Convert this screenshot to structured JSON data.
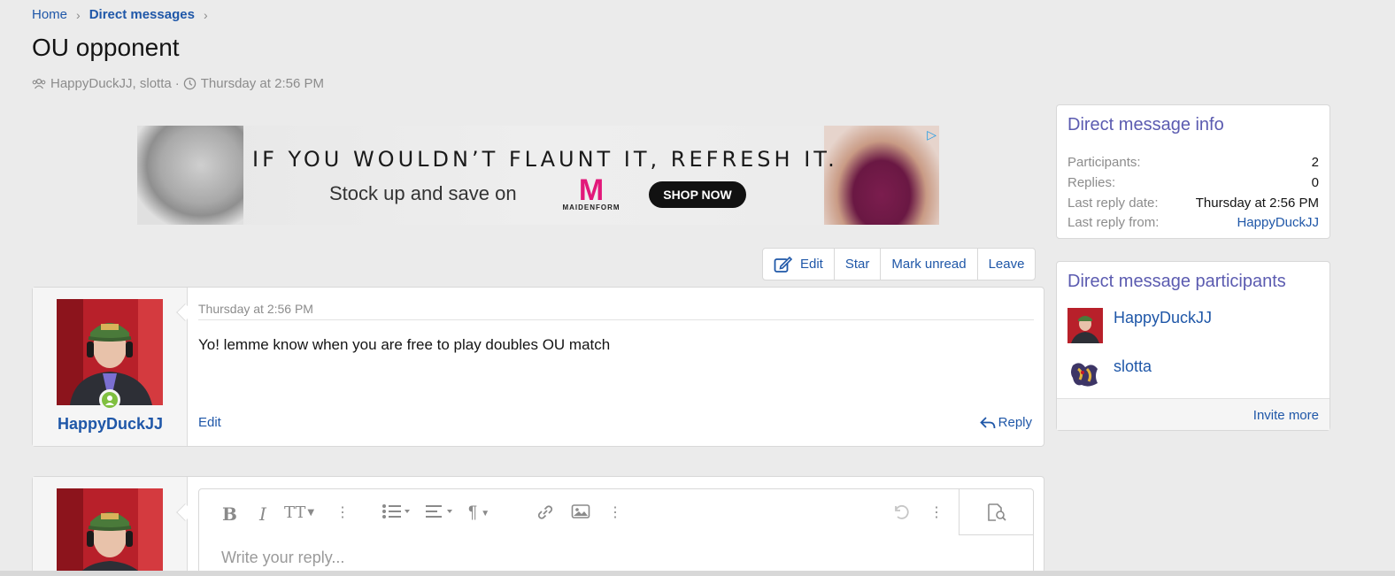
{
  "breadcrumb": {
    "home": "Home",
    "section": "Direct messages",
    "separator": "›"
  },
  "thread": {
    "title": "OU opponent",
    "participants_text": "HappyDuckJJ, slotta",
    "dot": "·",
    "date": "Thursday at 2:56 PM"
  },
  "ad": {
    "headline": "IF YOU WOULDN’T FLAUNT IT, REFRESH IT.",
    "subline": "Stock up and save on",
    "brand_mark": "M",
    "brand_name": "MAIDENFORM",
    "cta": "SHOP NOW",
    "badge": "▷"
  },
  "actions": {
    "edit": "Edit",
    "star": "Star",
    "mark_unread": "Mark unread",
    "leave": "Leave"
  },
  "message": {
    "author": "HappyDuckJJ",
    "date": "Thursday at 2:56 PM",
    "body": "Yo! lemme know when you are free to play doubles OU match",
    "edit_label": "Edit",
    "reply_label": "Reply"
  },
  "reply_editor": {
    "placeholder": "Write your reply...",
    "icons": [
      "bold-icon",
      "italic-icon",
      "text-size-icon",
      "more-vertical-icon",
      "list-icon",
      "align-icon",
      "paragraph-icon",
      "link-icon",
      "image-icon",
      "undo-icon",
      "preview-icon"
    ]
  },
  "info_block": {
    "title": "Direct message info",
    "rows": [
      {
        "label": "Participants:",
        "value": "2"
      },
      {
        "label": "Replies:",
        "value": "0"
      },
      {
        "label": "Last reply date:",
        "value": "Thursday at 2:56 PM"
      },
      {
        "label": "Last reply from:",
        "value": "HappyDuckJJ"
      }
    ]
  },
  "participants_block": {
    "title": "Direct message participants",
    "participants": [
      {
        "name": "HappyDuckJJ"
      },
      {
        "name": "slotta"
      }
    ],
    "invite_label": "Invite more"
  },
  "colors": {
    "link": "#1f57a8",
    "block_title": "#5b5bb0",
    "background": "#ebebeb",
    "online": "#7fbf3f"
  }
}
